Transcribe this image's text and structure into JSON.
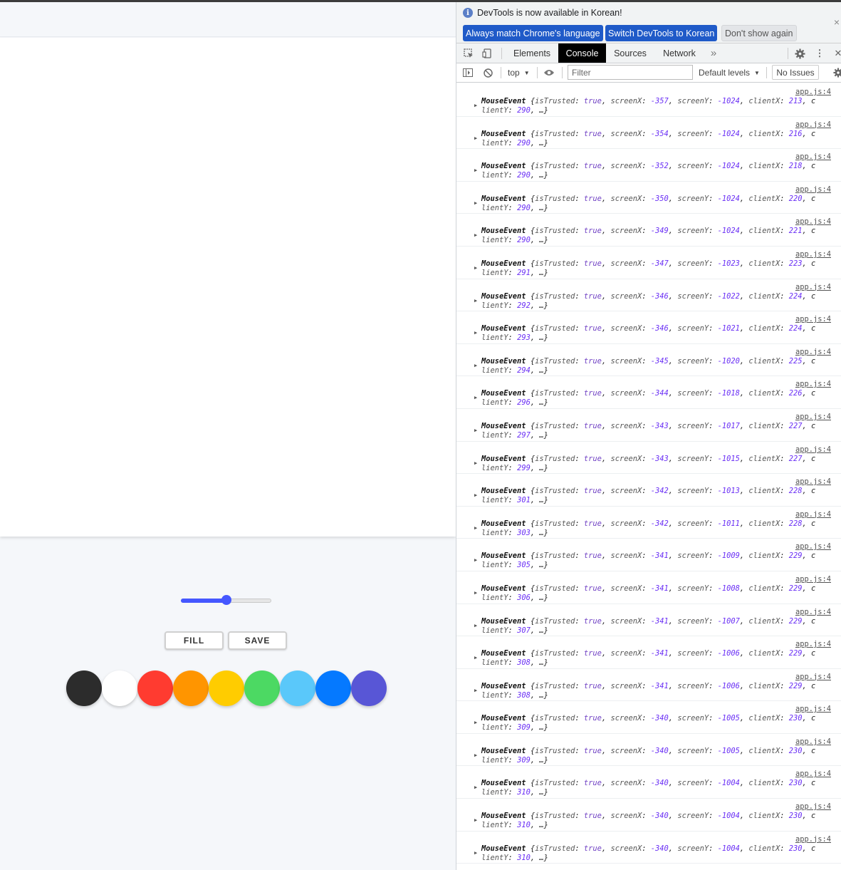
{
  "controls": {
    "slider_value_fraction": 0.5,
    "fill_label": "FILL",
    "save_label": "SAVE",
    "colors": [
      "#2c2c2c",
      "#ffffff",
      "#ff3b30",
      "#ff9500",
      "#ffcc00",
      "#4cd963",
      "#5ac8fa",
      "#0579ff",
      "#5856d6"
    ]
  },
  "devtools": {
    "info_text": "DevTools is now available in Korean!",
    "btn_always": "Always match Chrome's language",
    "btn_switch": "Switch DevTools to Korean",
    "btn_dont_show": "Don't show again",
    "tabs": [
      "Elements",
      "Console",
      "Sources",
      "Network"
    ],
    "more_tabs": "»",
    "context": "top",
    "filter_placeholder": "Filter",
    "levels": "Default levels",
    "issues": "No Issues",
    "logs": [
      {
        "src": "app.js:4",
        "obj": "MouseEvent",
        "screenX": "-357",
        "screenY": "-1024",
        "clientX": "213",
        "clientY": "290"
      },
      {
        "src": "app.js:4",
        "obj": "MouseEvent",
        "screenX": "-354",
        "screenY": "-1024",
        "clientX": "216",
        "clientY": "290"
      },
      {
        "src": "app.js:4",
        "obj": "MouseEvent",
        "screenX": "-352",
        "screenY": "-1024",
        "clientX": "218",
        "clientY": "290"
      },
      {
        "src": "app.js:4",
        "obj": "MouseEvent",
        "screenX": "-350",
        "screenY": "-1024",
        "clientX": "220",
        "clientY": "290"
      },
      {
        "src": "app.js:4",
        "obj": "MouseEvent",
        "screenX": "-349",
        "screenY": "-1024",
        "clientX": "221",
        "clientY": "290"
      },
      {
        "src": "app.js:4",
        "obj": "MouseEvent",
        "screenX": "-347",
        "screenY": "-1023",
        "clientX": "223",
        "clientY": "291"
      },
      {
        "src": "app.js:4",
        "obj": "MouseEvent",
        "screenX": "-346",
        "screenY": "-1022",
        "clientX": "224",
        "clientY": "292"
      },
      {
        "src": "app.js:4",
        "obj": "MouseEvent",
        "screenX": "-346",
        "screenY": "-1021",
        "clientX": "224",
        "clientY": "293"
      },
      {
        "src": "app.js:4",
        "obj": "MouseEvent",
        "screenX": "-345",
        "screenY": "-1020",
        "clientX": "225",
        "clientY": "294"
      },
      {
        "src": "app.js:4",
        "obj": "MouseEvent",
        "screenX": "-344",
        "screenY": "-1018",
        "clientX": "226",
        "clientY": "296"
      },
      {
        "src": "app.js:4",
        "obj": "MouseEvent",
        "screenX": "-343",
        "screenY": "-1017",
        "clientX": "227",
        "clientY": "297"
      },
      {
        "src": "app.js:4",
        "obj": "MouseEvent",
        "screenX": "-343",
        "screenY": "-1015",
        "clientX": "227",
        "clientY": "299"
      },
      {
        "src": "app.js:4",
        "obj": "MouseEvent",
        "screenX": "-342",
        "screenY": "-1013",
        "clientX": "228",
        "clientY": "301"
      },
      {
        "src": "app.js:4",
        "obj": "MouseEvent",
        "screenX": "-342",
        "screenY": "-1011",
        "clientX": "228",
        "clientY": "303"
      },
      {
        "src": "app.js:4",
        "obj": "MouseEvent",
        "screenX": "-341",
        "screenY": "-1009",
        "clientX": "229",
        "clientY": "305"
      },
      {
        "src": "app.js:4",
        "obj": "MouseEvent",
        "screenX": "-341",
        "screenY": "-1008",
        "clientX": "229",
        "clientY": "306"
      },
      {
        "src": "app.js:4",
        "obj": "MouseEvent",
        "screenX": "-341",
        "screenY": "-1007",
        "clientX": "229",
        "clientY": "307"
      },
      {
        "src": "app.js:4",
        "obj": "MouseEvent",
        "screenX": "-341",
        "screenY": "-1006",
        "clientX": "229",
        "clientY": "308"
      },
      {
        "src": "app.js:4",
        "obj": "MouseEvent",
        "screenX": "-341",
        "screenY": "-1006",
        "clientX": "229",
        "clientY": "308"
      },
      {
        "src": "app.js:4",
        "obj": "MouseEvent",
        "screenX": "-340",
        "screenY": "-1005",
        "clientX": "230",
        "clientY": "309"
      },
      {
        "src": "app.js:4",
        "obj": "MouseEvent",
        "screenX": "-340",
        "screenY": "-1005",
        "clientX": "230",
        "clientY": "309"
      },
      {
        "src": "app.js:4",
        "obj": "MouseEvent",
        "screenX": "-340",
        "screenY": "-1004",
        "clientX": "230",
        "clientY": "310"
      },
      {
        "src": "app.js:4",
        "obj": "MouseEvent",
        "screenX": "-340",
        "screenY": "-1004",
        "clientX": "230",
        "clientY": "310"
      },
      {
        "src": "app.js:4",
        "obj": "MouseEvent",
        "screenX": "-340",
        "screenY": "-1004",
        "clientX": "230",
        "clientY": "310"
      }
    ]
  }
}
